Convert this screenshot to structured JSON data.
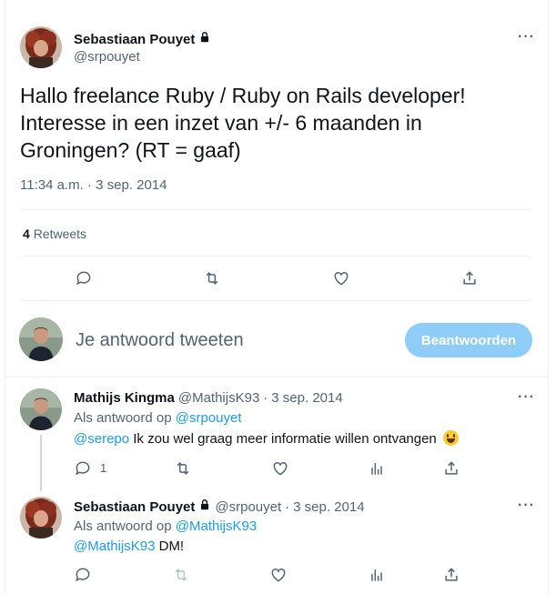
{
  "main_tweet": {
    "author_name": "Sebastiaan Pouyet",
    "author_handle": "@srpouyet",
    "text": "Hallo freelance Ruby / Ruby on Rails developer! Interesse in een inzet van +/- 6 maanden in Groningen? (RT = gaaf)",
    "timestamp": "11:34 a.m. · 3 sep. 2014",
    "retweet_count": "4",
    "retweet_label": "Retweets",
    "more_label": "···"
  },
  "composer": {
    "placeholder": "Je antwoord tweeten",
    "button_label": "Beantwoorden"
  },
  "replies": [
    {
      "name": "Mathijs Kingma",
      "handle": "@MathijsK93",
      "date": "3 sep. 2014",
      "reply_to_prefix": "Als antwoord op",
      "reply_to": "@srpouyet",
      "mention": "@serepo",
      "text": "Ik zou wel graag meer informatie willen ontvangen",
      "reply_count": "1"
    },
    {
      "name": "Sebastiaan Pouyet",
      "handle": "@srpouyet",
      "date": "3 sep. 2014",
      "reply_to_prefix": "Als antwoord op",
      "reply_to": "@MathijsK93",
      "mention": "@MathijsK93",
      "text": "DM!"
    }
  ],
  "colors": {
    "accent": "#1d9bf0",
    "button_disabled": "#8ecdf8",
    "secondary_text": "#536471"
  },
  "icons": [
    "lock-icon",
    "more-icon",
    "reply-icon",
    "retweet-icon",
    "like-icon",
    "share-icon",
    "views-icon",
    "smiley-emoji"
  ]
}
